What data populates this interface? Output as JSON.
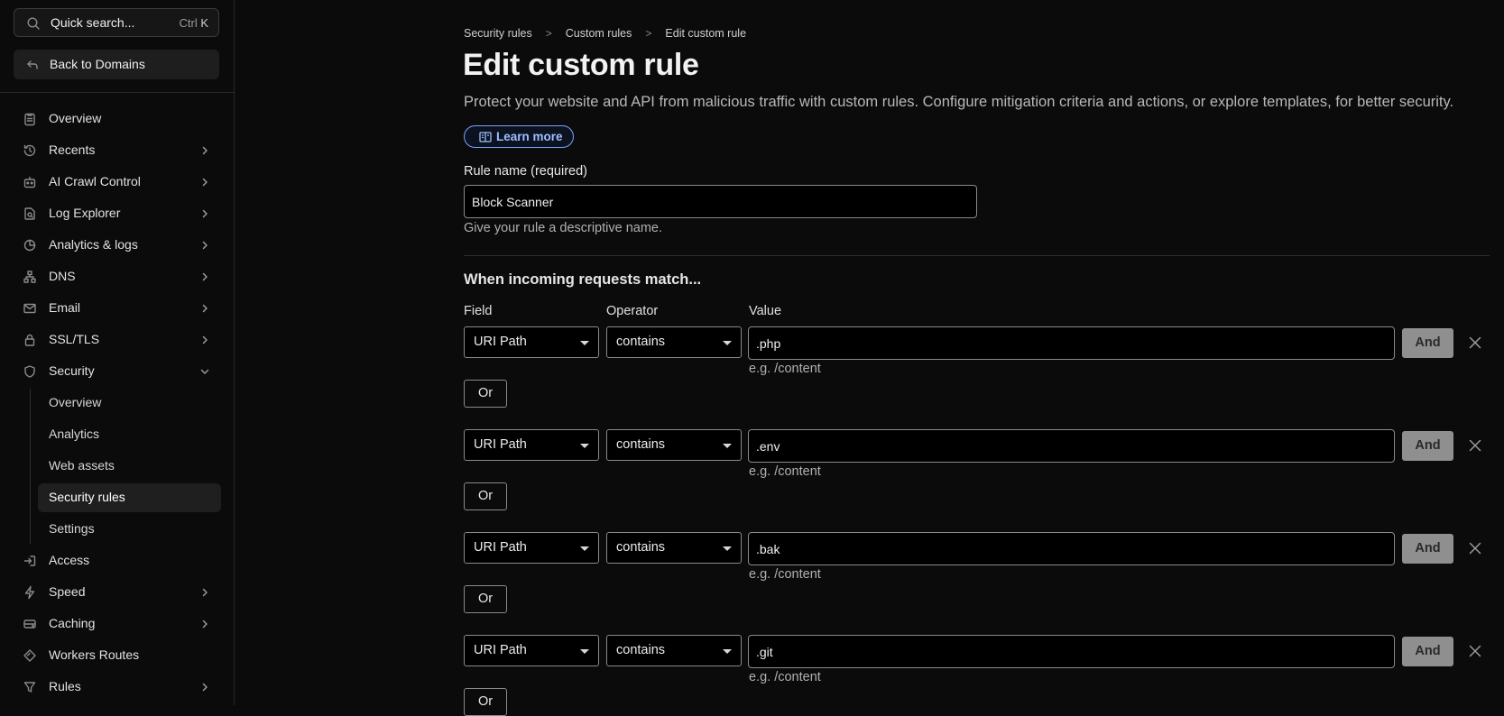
{
  "sidebar": {
    "search": {
      "label": "Quick search...",
      "shortcut_mod": "Ctrl",
      "shortcut_key": "K"
    },
    "back_label": "Back to Domains",
    "items": [
      {
        "label": "Overview"
      },
      {
        "label": "Recents"
      },
      {
        "label": "AI Crawl Control"
      },
      {
        "label": "Log Explorer"
      },
      {
        "label": "Analytics & logs"
      },
      {
        "label": "DNS"
      },
      {
        "label": "Email"
      },
      {
        "label": "SSL/TLS"
      },
      {
        "label": "Security",
        "expanded": true
      },
      {
        "label": "Access"
      },
      {
        "label": "Speed"
      },
      {
        "label": "Caching"
      },
      {
        "label": "Workers Routes"
      },
      {
        "label": "Rules"
      }
    ],
    "security_sub": [
      {
        "label": "Overview"
      },
      {
        "label": "Analytics"
      },
      {
        "label": "Web assets"
      },
      {
        "label": "Security rules",
        "active": true
      },
      {
        "label": "Settings"
      }
    ]
  },
  "breadcrumb": [
    "Security rules",
    "Custom rules",
    "Edit custom rule"
  ],
  "page": {
    "title": "Edit custom rule",
    "description": "Protect your website and API from malicious traffic with custom rules. Configure mitigation criteria and actions, or explore templates, for better security.",
    "learn_more": "Learn more"
  },
  "rule_name": {
    "label": "Rule name (required)",
    "value": "Block Scanner",
    "hint": "Give your rule a descriptive name."
  },
  "match": {
    "heading": "When incoming requests match...",
    "col_field": "Field",
    "col_operator": "Operator",
    "col_value": "Value",
    "value_hint": "e.g. /content",
    "and_label": "And",
    "or_label": "Or",
    "conditions": [
      {
        "field": "URI Path",
        "operator": "contains",
        "value": ".php"
      },
      {
        "field": "URI Path",
        "operator": "contains",
        "value": ".env"
      },
      {
        "field": "URI Path",
        "operator": "contains",
        "value": ".bak"
      },
      {
        "field": "URI Path",
        "operator": "contains",
        "value": ".git"
      }
    ]
  },
  "colors": {
    "background": "#0b0b0b",
    "accent_link": "#9cc0ff",
    "and_button": "#8f8f8f"
  }
}
